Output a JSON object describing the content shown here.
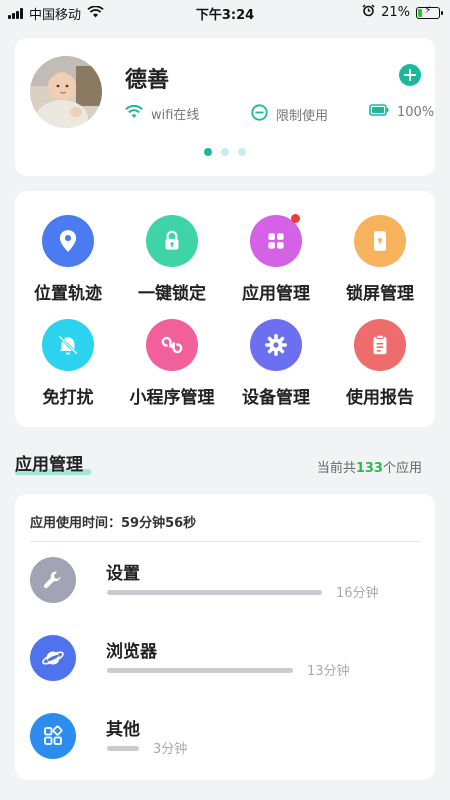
{
  "status_bar": {
    "carrier": "中国移动",
    "time": "下午3:24",
    "battery": "21%",
    "battery_level": 0.21
  },
  "profile": {
    "name": "德善",
    "wifi_status": "wifi在线",
    "mode": "限制使用",
    "battery": "100%",
    "carousel_total": 3,
    "carousel_active": 0
  },
  "features": [
    {
      "label": "位置轨迹",
      "icon": "location-icon",
      "color": "#4a7bf0"
    },
    {
      "label": "一键锁定",
      "icon": "lock-icon",
      "color": "#3ed4a8"
    },
    {
      "label": "应用管理",
      "icon": "grid-apps-icon",
      "color": "#d462e6",
      "badge": true
    },
    {
      "label": "锁屏管理",
      "icon": "phone-lock-icon",
      "color": "#f7b25c"
    },
    {
      "label": "免打扰",
      "icon": "bell-off-icon",
      "color": "#2bd3ee"
    },
    {
      "label": "小程序管理",
      "icon": "mini-program-icon",
      "color": "#f1609a"
    },
    {
      "label": "设备管理",
      "icon": "gear-icon",
      "color": "#6b6ff0"
    },
    {
      "label": "使用报告",
      "icon": "report-icon",
      "color": "#ef6c6c"
    }
  ],
  "app_section": {
    "title": "应用管理",
    "count_prefix": "当前共",
    "count": "133",
    "count_suffix": "个应用"
  },
  "usage": {
    "label": "应用使用时间：59分钟56秒"
  },
  "apps": [
    {
      "name": "设置",
      "time": "16分钟",
      "icon": "wrench-icon",
      "color": "#a1a4b5",
      "fraction": 1.0
    },
    {
      "name": "浏览器",
      "time": "13分钟",
      "icon": "planet-icon",
      "color": "#4f73ec",
      "fraction": 0.865
    },
    {
      "name": "其他",
      "time": "3分钟",
      "icon": "apps-icon",
      "color": "#2d8cf0",
      "fraction": 0.15
    }
  ]
}
